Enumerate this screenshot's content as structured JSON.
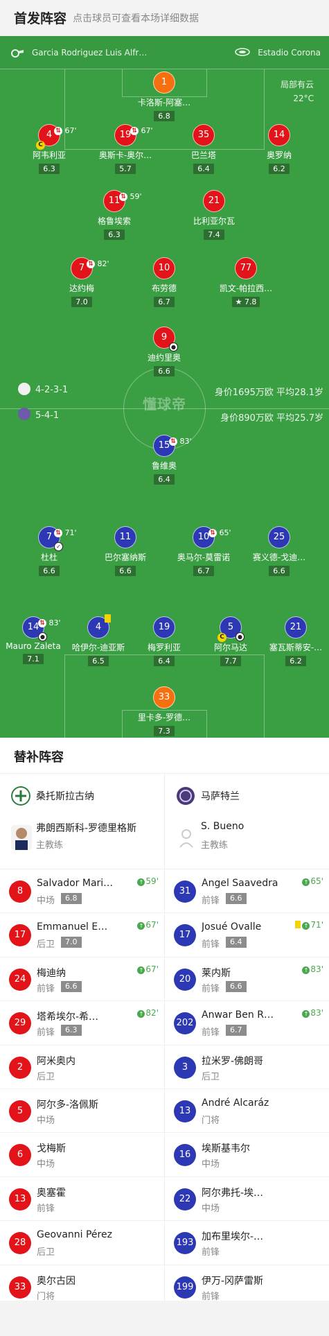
{
  "header": {
    "title": "首发阵容",
    "subtitle": "点击球员可查看本场详细数据"
  },
  "field": {
    "referee": "Garcia Rodriguez Luis Alfr…",
    "venue": "Estadio Corona",
    "weather": "局部有云",
    "temperature": "22°C",
    "watermark": "懂球帝",
    "home_formation": "4-2-3-1",
    "away_formation": "5-4-1",
    "home_stats": "身价1695万欧  平均28.1岁",
    "away_stats": "身价890万欧   平均25.7岁"
  },
  "home_players": [
    {
      "num": "1",
      "name": "卡洛斯-阿塞…",
      "rating": "6.8"
    },
    {
      "num": "4",
      "name": "阿韦利亚",
      "rating": "6.3",
      "sub": "67'"
    },
    {
      "num": "19",
      "name": "奥斯卡-奥尔…",
      "rating": "5.7",
      "sub": "67'"
    },
    {
      "num": "35",
      "name": "巴兰塔",
      "rating": "6.4"
    },
    {
      "num": "14",
      "name": "奥罗纳",
      "rating": "6.2"
    },
    {
      "num": "11",
      "name": "格鲁埃索",
      "rating": "6.3",
      "sub": "59'"
    },
    {
      "num": "21",
      "name": "比利亚尔瓦",
      "rating": "7.4"
    },
    {
      "num": "7",
      "name": "达约梅",
      "rating": "7.0",
      "sub": "82'"
    },
    {
      "num": "10",
      "name": "布劳德",
      "rating": "6.7"
    },
    {
      "num": "77",
      "name": "凯文-帕拉西…",
      "rating": "7.8"
    },
    {
      "num": "9",
      "name": "迪约里奥",
      "rating": "6.6"
    }
  ],
  "away_players": [
    {
      "num": "15",
      "name": "鲁维奥",
      "rating": "6.4",
      "sub": "83'"
    },
    {
      "num": "7",
      "name": "杜杜",
      "rating": "6.6",
      "sub": "71'"
    },
    {
      "num": "11",
      "name": "巴尔塞纳斯",
      "rating": "6.6"
    },
    {
      "num": "10",
      "name": "奥马尔-莫雷诺",
      "rating": "6.7",
      "sub": "65'"
    },
    {
      "num": "25",
      "name": "赛义德-戈迪…",
      "rating": "6.6"
    },
    {
      "num": "14",
      "name": "Mauro Zaleta",
      "rating": "7.1",
      "sub": "83'"
    },
    {
      "num": "4",
      "name": "哈伊尔-迪亚斯",
      "rating": "6.5"
    },
    {
      "num": "19",
      "name": "梅罗利亚",
      "rating": "6.4"
    },
    {
      "num": "5",
      "name": "阿尔马达",
      "rating": "7.7"
    },
    {
      "num": "21",
      "name": "塞瓦斯蒂安-…",
      "rating": "6.2"
    },
    {
      "num": "33",
      "name": "里卡多-罗德…",
      "rating": "7.3"
    }
  ],
  "subs_section": {
    "title": "替补阵容",
    "home_team": "桑托斯拉古纳",
    "away_team": "马萨特兰",
    "home_coach": {
      "name": "弗朗西斯科-罗德里格斯",
      "role": "主教练"
    },
    "away_coach": {
      "name": "S. Bueno",
      "role": "主教练"
    },
    "home_subs": [
      {
        "num": "8",
        "name": "Salvador Mari…",
        "pos": "中场",
        "rating": "6.8",
        "minute": "59'"
      },
      {
        "num": "17",
        "name": "Emmanuel E…",
        "pos": "后卫",
        "rating": "7.0",
        "minute": "67'"
      },
      {
        "num": "24",
        "name": "梅迪纳",
        "pos": "前锋",
        "rating": "6.6",
        "minute": "67'"
      },
      {
        "num": "29",
        "name": "塔希埃尔-希…",
        "pos": "前锋",
        "rating": "6.3",
        "minute": "82'"
      },
      {
        "num": "2",
        "name": "阿米奥内",
        "pos": "后卫"
      },
      {
        "num": "5",
        "name": "阿尔多-洛佩斯",
        "pos": "中场"
      },
      {
        "num": "6",
        "name": "戈梅斯",
        "pos": "中场"
      },
      {
        "num": "13",
        "name": "奥塞霍",
        "pos": "前锋"
      },
      {
        "num": "28",
        "name": "Geovanni Pérez",
        "pos": "后卫"
      },
      {
        "num": "33",
        "name": "奥尔古因",
        "pos": "门将"
      }
    ],
    "away_subs": [
      {
        "num": "31",
        "name": "Ángel Saavedra",
        "pos": "前锋",
        "rating": "6.6",
        "minute": "65'"
      },
      {
        "num": "17",
        "name": "Josué Ovalle",
        "pos": "前锋",
        "rating": "6.4",
        "minute": "71'"
      },
      {
        "num": "20",
        "name": "莱内斯",
        "pos": "前锋",
        "rating": "6.6",
        "minute": "83'"
      },
      {
        "num": "202",
        "name": "Anwar Ben R…",
        "pos": "前锋",
        "rating": "6.7",
        "minute": "83'"
      },
      {
        "num": "3",
        "name": "拉米罗-佛朗哥",
        "pos": "后卫"
      },
      {
        "num": "13",
        "name": "André Alcaráz",
        "pos": "门将"
      },
      {
        "num": "16",
        "name": "埃斯基韦尔",
        "pos": "中场"
      },
      {
        "num": "22",
        "name": "阿尔弗托-埃…",
        "pos": "中场"
      },
      {
        "num": "193",
        "name": "加布里埃尔-…",
        "pos": "前锋"
      },
      {
        "num": "199",
        "name": "伊万-冈萨雷斯",
        "pos": "前锋"
      }
    ]
  }
}
